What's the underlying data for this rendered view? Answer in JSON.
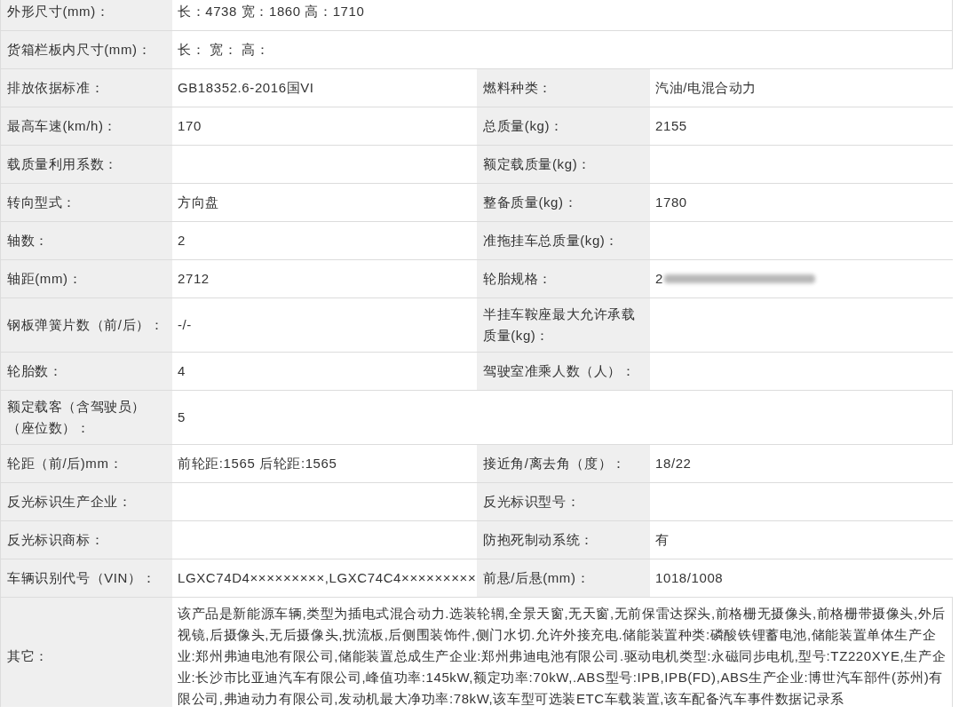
{
  "rows": [
    {
      "kind": "wide",
      "label": "外形尺寸(mm)：",
      "value": "长：4738 宽：1860 高：1710"
    },
    {
      "kind": "wide",
      "label": "货箱栏板内尺寸(mm)：",
      "value": "长：  宽：  高："
    },
    {
      "kind": "pair",
      "label": "排放依据标准：",
      "value": "GB18352.6-2016国VI",
      "label2": "燃料种类：",
      "value2": "汽油/电混合动力"
    },
    {
      "kind": "pair",
      "label": "最高车速(km/h)：",
      "value": "170",
      "label2": "总质量(kg)：",
      "value2": "2155"
    },
    {
      "kind": "pair",
      "label": "载质量利用系数：",
      "label2": "额定载质量(kg)："
    },
    {
      "kind": "pair",
      "label": "转向型式：",
      "value": "方向盘",
      "label2": "整备质量(kg)：",
      "value2": "1780"
    },
    {
      "kind": "pair",
      "label": "轴数：",
      "value": "2",
      "label2": "准拖挂车总质量(kg)："
    },
    {
      "kind": "pair",
      "label": "轴距(mm)：",
      "value": "2712",
      "label2": "轮胎规格：",
      "value2": "2",
      "redacted2": true
    },
    {
      "kind": "pair",
      "label": "钢板弹簧片数（前/后）：",
      "value": "-/-",
      "label2": "半挂车鞍座最大允许承载质量(kg)："
    },
    {
      "kind": "pair",
      "label": "轮胎数：",
      "value": "4",
      "label2": "驾驶室准乘人数（人）："
    },
    {
      "kind": "wide",
      "label": "额定载客（含驾驶员）（座位数）：",
      "value": "5"
    },
    {
      "kind": "pair",
      "label": "轮距（前/后)mm：",
      "value": "前轮距:1565 后轮距:1565",
      "label2": "接近角/离去角（度）：",
      "value2": "18/22"
    },
    {
      "kind": "pair",
      "label": "反光标识生产企业：",
      "label2": "反光标识型号："
    },
    {
      "kind": "pair",
      "label": "反光标识商标：",
      "label2": "防抱死制动系统：",
      "value2": "有"
    },
    {
      "kind": "pair",
      "label": "车辆识别代号（VIN）：",
      "value": "LGXC74D4×××××××××,LGXC74C4×××××××××",
      "label2": "前悬/后悬(mm)：",
      "value2": "1018/1008"
    },
    {
      "kind": "wide",
      "label": "其它：",
      "value": "该产品是新能源车辆,类型为插电式混合动力.选装轮辋,全景天窗,无天窗,无前保雷达探头,前格栅无摄像头,前格栅带摄像头,外后视镜,后摄像头,无后摄像头,扰流板,后侧围装饰件,侧门水切.允许外接充电.储能装置种类:磷酸铁锂蓄电池,储能装置单体生产企业:郑州弗迪电池有限公司,储能装置总成生产企业:郑州弗迪电池有限公司.驱动电机类型:永磁同步电机,型号:TZ220XYE,生产企业:长沙市比亚迪汽车有限公司,峰值功率:145kW,额定功率:70kW,.ABS型号:IPB,IPB(FD),ABS生产企业:博世汽车部件(苏州)有限公司,弗迪动力有限公司,发动机最大净功率:78kW,该车型可选装ETC车载装置,该车配备汽车事件数据记录系"
    }
  ]
}
